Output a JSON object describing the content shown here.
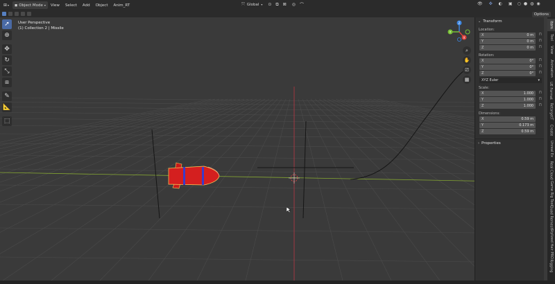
{
  "header": {
    "mode": "Object Mode",
    "menus": [
      "View",
      "Select",
      "Add",
      "Object",
      "Anim_RT"
    ],
    "transform_orientation": "Global",
    "options_label": "Options"
  },
  "viewport": {
    "perspective_label": "User Perspective",
    "collection_label": "(1) Collection 2 | Missile"
  },
  "toolbar": {
    "tools": [
      "select-box",
      "cursor",
      "move",
      "rotate",
      "scale",
      "transform",
      "annotate",
      "measure",
      "add-cube"
    ],
    "active": "select-box"
  },
  "nav_gizmo": {
    "axes": {
      "x": "X",
      "y": "Y",
      "z": "Z"
    },
    "colors": {
      "x": "#e0413c",
      "y": "#78c135",
      "z": "#3a84e0"
    }
  },
  "transform_panel": {
    "title": "Transform",
    "location_label": "Location:",
    "location": [
      {
        "axis": "X",
        "value": "0 m"
      },
      {
        "axis": "Y",
        "value": "0 m"
      },
      {
        "axis": "Z",
        "value": "0 m"
      }
    ],
    "rotation_label": "Rotation:",
    "rotation": [
      {
        "axis": "X",
        "value": "0°"
      },
      {
        "axis": "Y",
        "value": "0°"
      },
      {
        "axis": "Z",
        "value": "0°"
      }
    ],
    "rotation_mode": "XYZ Euler",
    "scale_label": "Scale:",
    "scale": [
      {
        "axis": "X",
        "value": "1.000"
      },
      {
        "axis": "Y",
        "value": "1.000"
      },
      {
        "axis": "Z",
        "value": "1.000"
      }
    ],
    "dimensions_label": "Dimensions:",
    "dimensions": [
      {
        "axis": "X",
        "value": "0.59 m"
      },
      {
        "axis": "Y",
        "value": "0.173 m"
      },
      {
        "axis": "Z",
        "value": "0.59 m"
      }
    ]
  },
  "properties_panel": {
    "title": "Properties"
  },
  "sidebar_tabs": [
    "Item",
    "Tool",
    "View",
    "Animation",
    "UE Format",
    "RetargetT",
    "Create",
    "Unreal Ex",
    "Real Cloud",
    "Game Rig Tool",
    "Quad Remesh",
    "Stylized Hair PRO",
    "Rigging"
  ],
  "colors": {
    "viewport_bg": "#3a3a3a",
    "grid": "#4b4b4b",
    "x_axis": "#b83642",
    "y_axis": "#86a832",
    "missile": "#d41f1f",
    "accent": "#4a6aa5"
  }
}
